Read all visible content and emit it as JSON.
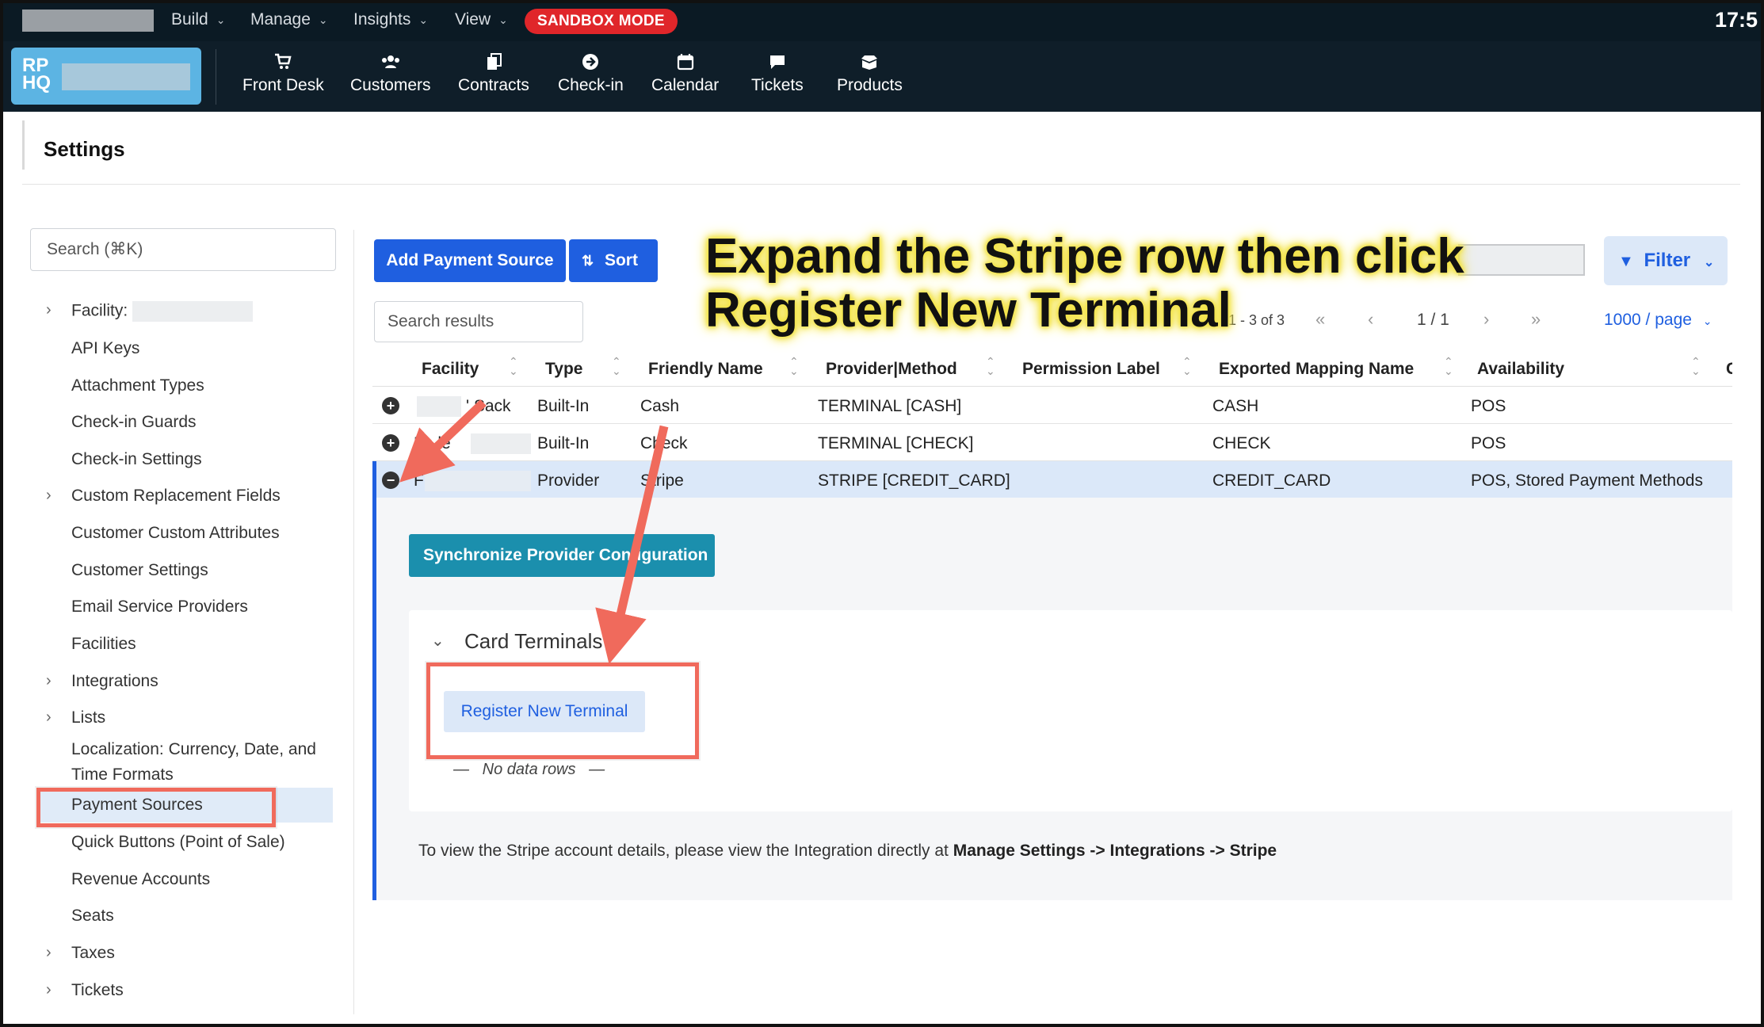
{
  "menubar": {
    "items": [
      {
        "label": "Build"
      },
      {
        "label": "Manage"
      },
      {
        "label": "Insights"
      },
      {
        "label": "View"
      }
    ],
    "sandbox_label": "SANDBOX MODE",
    "clock": "17:5"
  },
  "brand": {
    "logo_text": "RP\nHQ"
  },
  "nav": [
    {
      "label": "Front Desk",
      "icon": "cart-icon"
    },
    {
      "label": "Customers",
      "icon": "users-icon"
    },
    {
      "label": "Contracts",
      "icon": "contracts-icon"
    },
    {
      "label": "Check-in",
      "icon": "arrow-circle-icon"
    },
    {
      "label": "Calendar",
      "icon": "calendar-icon"
    },
    {
      "label": "Tickets",
      "icon": "chat-icon"
    },
    {
      "label": "Products",
      "icon": "box-icon"
    }
  ],
  "settings": {
    "title": "Settings"
  },
  "sidebar": {
    "search_placeholder": "Search (⌘K)",
    "items": [
      {
        "label": "Facility:",
        "caret": true
      },
      {
        "label": "API Keys"
      },
      {
        "label": "Attachment Types"
      },
      {
        "label": "Check-in Guards"
      },
      {
        "label": "Check-in Settings"
      },
      {
        "label": "Custom Replacement Fields",
        "caret": true
      },
      {
        "label": "Customer Custom Attributes"
      },
      {
        "label": "Customer Settings"
      },
      {
        "label": "Email Service Providers"
      },
      {
        "label": "Facilities"
      },
      {
        "label": "Integrations",
        "caret": true
      },
      {
        "label": "Lists",
        "caret": true
      },
      {
        "label": "Localization: Currency, Date, and"
      },
      {
        "label": "Time Formats"
      },
      {
        "label": "Payment Sources",
        "selected": true
      },
      {
        "label": "Quick Buttons (Point of Sale)"
      },
      {
        "label": "Revenue Accounts"
      },
      {
        "label": "Seats"
      },
      {
        "label": "Taxes",
        "caret": true
      },
      {
        "label": "Tickets",
        "caret": true
      }
    ]
  },
  "toolbar": {
    "add_label": "Add Payment Source",
    "sort_label": "Sort",
    "search_placeholder": "Search results",
    "filter_label": "Filter",
    "range_label": "1 - 3 of 3",
    "page_label": "1 / 1",
    "per_page_label": "1000 / page"
  },
  "table": {
    "columns": [
      "Facility",
      "Type",
      "Friendly Name",
      "Provider|Method",
      "Permission Label",
      "Exported Mapping Name",
      "Availability",
      "C"
    ],
    "rows": [
      {
        "facility": "' Sack",
        "type": "Built-In",
        "friendly": "Cash",
        "provider": "TERMINAL [CASH]",
        "permission": "",
        "mapping": "CASH",
        "availability": "POS",
        "expanded": false
      },
      {
        "facility": "Fo  le",
        "type": "Built-In",
        "friendly": "Check",
        "provider": "TERMINAL [CHECK]",
        "permission": "",
        "mapping": "CHECK",
        "availability": "POS",
        "expanded": false
      },
      {
        "facility": "F",
        "type": "Provider",
        "friendly": "Stripe",
        "provider": "STRIPE [CREDIT_CARD]",
        "permission": "",
        "mapping": "CREDIT_CARD",
        "availability": "POS, Stored Payment Methods",
        "expanded": true
      }
    ]
  },
  "expanded": {
    "sync_label": "Synchronize Provider Configuration",
    "terminals_title": "Card Terminals",
    "register_label": "Register New Terminal",
    "no_data": "No data rows",
    "info_prefix": "To view the Stripe account details, please view the Integration directly at ",
    "info_bold": "Manage Settings -> Integrations -> Stripe"
  },
  "annotation": {
    "line1": "Expand the Stripe row then click",
    "line2": "Register New Terminal",
    "color": "#f06a5c",
    "highlight": "#f3e44a"
  }
}
